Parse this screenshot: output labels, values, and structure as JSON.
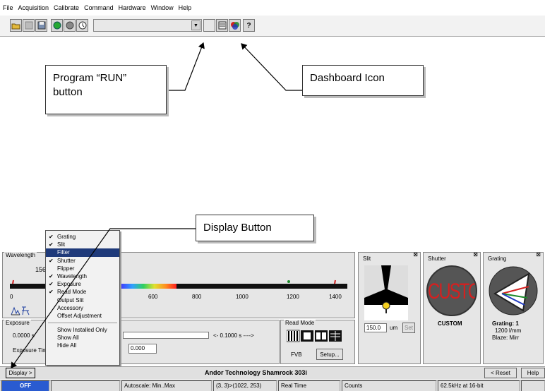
{
  "menubar": {
    "items": [
      "File",
      "Acquisition",
      "Calibrate",
      "Command",
      "Hardware",
      "Window",
      "Help"
    ]
  },
  "toolbar": {
    "buttons": [
      "open-icon",
      "save-disabled-icon",
      "save-icon",
      "run-icon",
      "stop-icon",
      "timer-icon"
    ],
    "combo_value": "",
    "right_buttons": [
      "blank-icon",
      "dashboard-icon",
      "color-icon",
      "help-icon"
    ],
    "help_glyph": "?"
  },
  "callouts": {
    "run": "Program “RUN” button",
    "dashboard": "Dashboard Icon",
    "display": "Display Button"
  },
  "dropdown": {
    "items": [
      {
        "label": "Grating",
        "checked": true
      },
      {
        "label": "Slit",
        "checked": true
      },
      {
        "label": "Filter",
        "checked": false,
        "selected": true
      },
      {
        "label": "Shutter",
        "checked": true
      },
      {
        "label": "Flipper",
        "checked": false
      },
      {
        "label": "Wavelength",
        "checked": true
      },
      {
        "label": "Exposure",
        "checked": true
      },
      {
        "label": "Read Mode",
        "checked": true
      },
      {
        "label": "Output Slit",
        "checked": false
      },
      {
        "label": "Accessory",
        "checked": false
      },
      {
        "label": "Offset Adjustment",
        "checked": false
      }
    ],
    "extra": [
      "Show Installed Only",
      "Show All",
      "Hide All"
    ]
  },
  "wavelength": {
    "title": "Wavelength",
    "value_partial": "156.",
    "ticks": [
      "0",
      "600",
      "800",
      "1000",
      "1200",
      "1400"
    ]
  },
  "exposure": {
    "title": "Exposure",
    "value": "0.0000 s",
    "limit_label": "<- 0.1000 s ---->",
    "time_label": "Exposure Tim",
    "time_value": "0.000"
  },
  "readmode": {
    "title": "Read Mode",
    "mode": "FVB",
    "setup": "Setup..."
  },
  "slit": {
    "title": "Slit",
    "value": "150.0",
    "unit": "um",
    "set": "Set"
  },
  "shutter": {
    "title": "Shutter",
    "logo_text": "CUSTOM",
    "caption": "CUSTOM"
  },
  "grating": {
    "title": "Grating",
    "line1": "Grating: 1",
    "line2": "1200 l/mm",
    "line3": "Blaze: Mirr"
  },
  "bottombar": {
    "display": "Display >",
    "title": "Andor Technology Shamrock 303i",
    "reset": "< Reset",
    "help": "Help"
  },
  "statusbar": {
    "off": "OFF",
    "autoscale": "Autoscale: Min..Max",
    "coords": "(3, 3)>(1022, 253)",
    "mode": "Real Time",
    "units": "Counts",
    "rate": "62.5kHz at 16-bit"
  },
  "colors": {
    "accent": "#1f3a7a",
    "off": "#2a5bd0",
    "shutter_red": "#d42020"
  }
}
